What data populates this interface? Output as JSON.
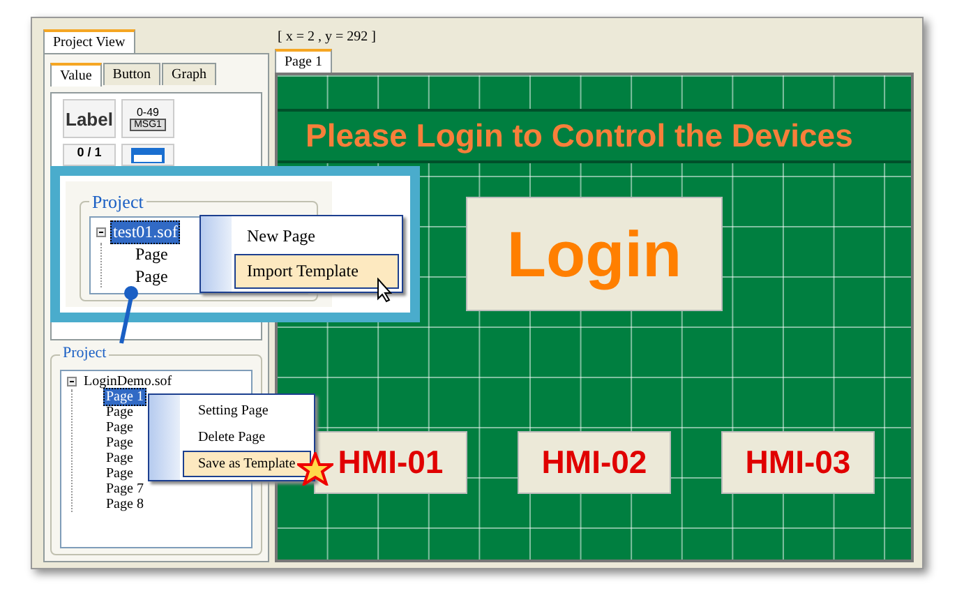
{
  "left_panel": {
    "tab": "Project View",
    "subtabs": [
      {
        "label": "Value",
        "selected": true
      },
      {
        "label": "Button",
        "selected": false
      },
      {
        "label": "Graph",
        "selected": false
      }
    ],
    "tools": [
      {
        "kind": "label",
        "texts": [
          "Label"
        ]
      },
      {
        "kind": "message",
        "texts": [
          "0-49",
          "MSG1"
        ]
      },
      {
        "kind": "binary",
        "texts": [
          "0 / 1"
        ]
      },
      {
        "kind": "calendar"
      }
    ]
  },
  "project": {
    "title": "Project",
    "tree": {
      "label": "LoginDemo.sof",
      "expanded": true,
      "selected": false,
      "children": [
        {
          "label": "Page 1",
          "selected": true
        },
        {
          "label": "Page",
          "selected": false
        },
        {
          "label": "Page",
          "selected": false
        },
        {
          "label": "Page",
          "selected": false
        },
        {
          "label": "Page",
          "selected": false
        },
        {
          "label": "Page",
          "selected": false
        },
        {
          "label": "Page 7",
          "selected": false
        },
        {
          "label": "Page 8",
          "selected": false
        }
      ]
    },
    "context_menu": [
      {
        "label": "Setting Page",
        "selected": false
      },
      {
        "label": "Delete Page",
        "selected": false
      },
      {
        "label": "Save as Template",
        "selected": true
      }
    ]
  },
  "inset": {
    "title": "Project",
    "tree": {
      "label": "test01.sof",
      "expanded": true,
      "selected": true,
      "children": [
        {
          "label": "Page",
          "selected": false
        },
        {
          "label": "Page",
          "selected": false
        }
      ]
    },
    "context_menu": [
      {
        "label": "New Page",
        "selected": false
      },
      {
        "label": "Import Template",
        "selected": true
      }
    ]
  },
  "coordinates": "[ x = 2 , y = 292 ]",
  "page_tabs": [
    {
      "label": "Page 1",
      "selected": true
    }
  ],
  "canvas": {
    "heading": "Please Login to Control the Devices",
    "login_button": "Login",
    "device_buttons": [
      "HMI-01",
      "HMI-02",
      "HMI-03"
    ]
  }
}
